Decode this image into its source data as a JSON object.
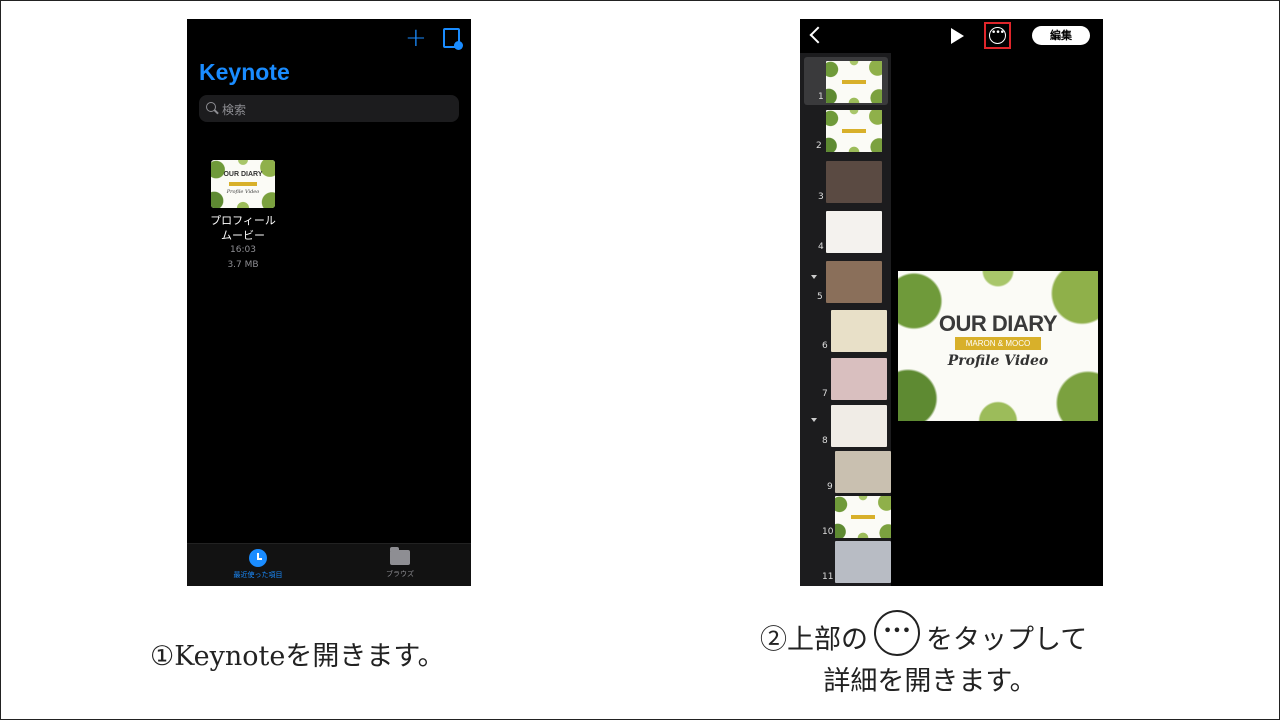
{
  "left_phone": {
    "app_title": "Keynote",
    "search_placeholder": "検索",
    "document": {
      "name": "プロフィールムービー",
      "time": "16:03",
      "size": "3.7 MB",
      "thumb_title": "OUR DIARY",
      "thumb_sub": "Profile Video"
    },
    "tabs": [
      {
        "label": "最近使った項目",
        "icon": "clock-icon",
        "active": true
      },
      {
        "label": "ブラウズ",
        "icon": "folder-icon",
        "active": false
      }
    ],
    "icons": {
      "add": "plus-icon",
      "doc": "document-icon"
    }
  },
  "right_phone": {
    "edit_label": "編集",
    "more_symbol": "•••",
    "slide_numbers": [
      "1",
      "2",
      "3",
      "4",
      "5",
      "6",
      "7",
      "8",
      "9",
      "10",
      "11"
    ],
    "main_slide": {
      "title": "OUR DIARY",
      "bar_text": "MARON & MOCO",
      "script": "Profile Video"
    },
    "highlight_color": "#e0262b"
  },
  "captions": {
    "step1": "①Keynoteを開きます。",
    "step2_a": "②上部の",
    "step2_b": "をタップして",
    "step2_c": "詳細を開きます。",
    "inline_symbol": "•••"
  },
  "colors": {
    "accent_blue": "#1a8cff",
    "gold_bar": "#d8b02a"
  }
}
